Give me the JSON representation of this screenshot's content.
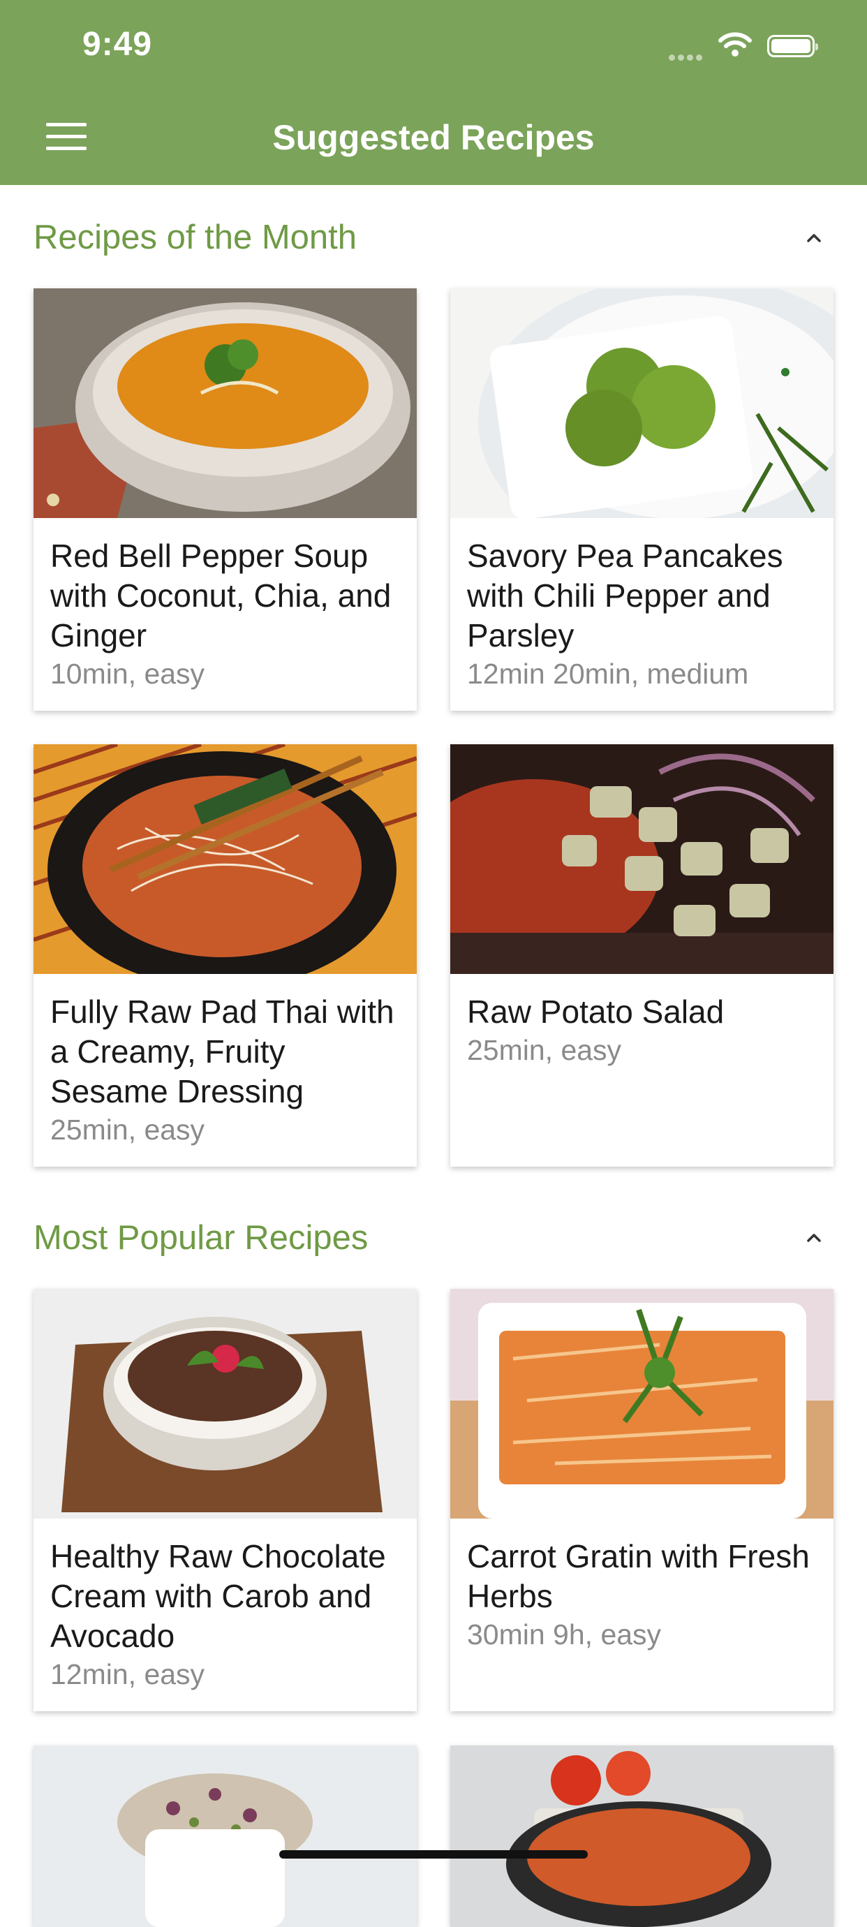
{
  "status_bar": {
    "time": "9:49"
  },
  "header": {
    "title": "Suggested Recipes"
  },
  "sections": [
    {
      "title": "Recipes of the Month",
      "recipes": [
        {
          "name": "Red Bell Pepper Soup with Coconut, Chia, and Ginger",
          "meta": "10min, easy"
        },
        {
          "name": "Savory Pea Pancakes with Chili Pepper and Parsley",
          "meta": "12min 20min, medium"
        },
        {
          "name": "Fully Raw Pad Thai with a Creamy, Fruity Sesame Dressing",
          "meta": "25min, easy"
        },
        {
          "name": "Raw Potato Salad",
          "meta": "25min, easy"
        }
      ]
    },
    {
      "title": "Most Popular Recipes",
      "recipes": [
        {
          "name": "Healthy Raw Chocolate Cream with Carob and Avocado",
          "meta": "12min, easy"
        },
        {
          "name": "Carrot Gratin with Fresh Herbs",
          "meta": "30min 9h, easy"
        }
      ]
    }
  ],
  "colors": {
    "header": "#7ba35a",
    "section_title": "#6f9a45"
  },
  "icons": {
    "menu": "hamburger-menu-icon",
    "collapse": "chevron-up-icon",
    "wifi": "wifi-icon",
    "battery": "battery-icon"
  }
}
